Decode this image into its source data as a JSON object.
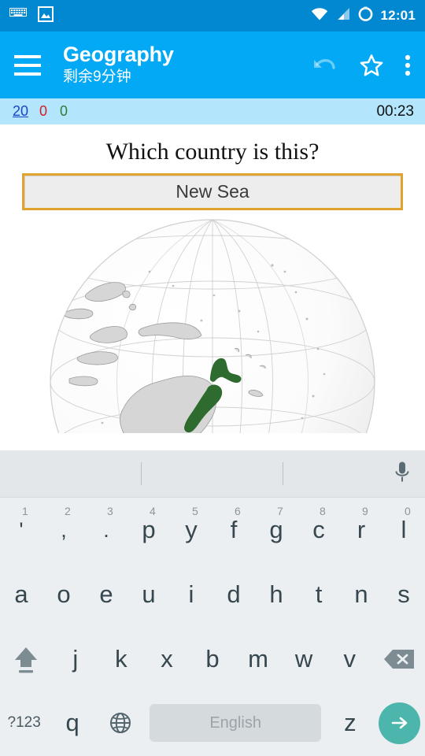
{
  "status_bar": {
    "icons_left": [
      "keyboard-icon",
      "image-icon"
    ],
    "icons_right": [
      "wifi-icon",
      "cell-signal-icon",
      "battery-circle-icon"
    ],
    "time": "12:01",
    "background": "#0288D1"
  },
  "app_bar": {
    "menu_icon": "hamburger-menu-icon",
    "title": "Geography",
    "subtitle": "剩余9分钟",
    "actions": [
      "undo-icon",
      "star-icon",
      "overflow-menu-icon"
    ],
    "background": "#03A9F4"
  },
  "score_bar": {
    "remaining": "20",
    "wrong": "0",
    "correct": "0",
    "timer": "00:23",
    "remaining_color": "#1A44C8",
    "wrong_color": "#D32020",
    "correct_color": "#2E7D32",
    "background": "#B3E5FC"
  },
  "quiz": {
    "question": "Which country is this?",
    "answer_value": "New Sea",
    "answer_placeholder": "",
    "answer_border_color": "#E0A32E",
    "answer_fill_color": "#EDEDED",
    "image_alt": "orthographic-globe-oceania",
    "highlight_color": "#2E6B2E",
    "land_color": "#D6D6D6",
    "ocean_color": "#F7F7F7"
  },
  "keyboard": {
    "layout_name": "dvorak",
    "suggestions": [
      "",
      "",
      ""
    ],
    "mic_icon": "microphone-icon",
    "row1": [
      {
        "key": "'",
        "hint": "1"
      },
      {
        "key": ",",
        "hint": "2"
      },
      {
        "key": ".",
        "hint": "3"
      },
      {
        "key": "p",
        "hint": "4"
      },
      {
        "key": "y",
        "hint": "5"
      },
      {
        "key": "f",
        "hint": "6"
      },
      {
        "key": "g",
        "hint": "7"
      },
      {
        "key": "c",
        "hint": "8"
      },
      {
        "key": "r",
        "hint": "9"
      },
      {
        "key": "l",
        "hint": "0"
      }
    ],
    "row2": [
      "a",
      "o",
      "e",
      "u",
      "i",
      "d",
      "h",
      "t",
      "n",
      "s"
    ],
    "row3_shift": "shift-icon",
    "row3": [
      "j",
      "k",
      "x",
      "b",
      "m",
      "w",
      "v"
    ],
    "row3_backspace": "backspace-icon",
    "row4": {
      "symbols_label": "?123",
      "letter_left": "q",
      "language_icon": "globe-language-icon",
      "space_label": "English",
      "letter_right": "z",
      "enter_icon": "arrow-right-enter-icon",
      "enter_color": "#4DB6AC",
      "space_color": "#D5DADD"
    },
    "background": "#EBEFF1",
    "suggestion_background": "#E3E7E9"
  }
}
